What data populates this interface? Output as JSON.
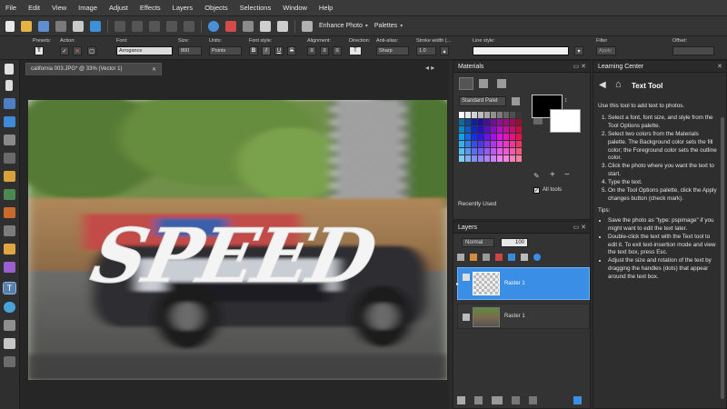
{
  "menu": [
    "File",
    "Edit",
    "View",
    "Image",
    "Adjust",
    "Effects",
    "Layers",
    "Objects",
    "Selections",
    "Window",
    "Help"
  ],
  "toolbar": {
    "enhance_photo": "Enhance Photo",
    "palettes": "Palettes"
  },
  "tool_options": {
    "presets_label": "Presets:",
    "action_label": "Action:",
    "font_label": "Font:",
    "font_value": "Arrogance",
    "size_label": "Size:",
    "size_value": "800",
    "units_label": "Units:",
    "units_value": "Points",
    "font_style_label": "Font style:",
    "font_style_buttons": [
      "B",
      "I",
      "U",
      "S"
    ],
    "alignment_label": "Alignment:",
    "direction_label": "Direction:",
    "antialias_label": "Anti-alias:",
    "antialias_value": "Sharp",
    "stroke_width_label": "Stroke width (...",
    "stroke_width_value": "1.0",
    "line_style_label": "Line style:",
    "filter_label": "Filter",
    "filter_value": "Apply",
    "offset_label": "Offset:"
  },
  "document": {
    "tab_title": "california 003.JPG* @ 33% (Vector 1)",
    "text_overlay": "SPEED"
  },
  "materials": {
    "title": "Materials",
    "palette_select": "Standard Palet",
    "all_tools": "All tools",
    "recently_used": "Recently Used"
  },
  "layers": {
    "title": "Layers",
    "blend_mode": "Normal",
    "opacity": "100",
    "items": [
      {
        "name": "Raster 1",
        "selected": true
      },
      {
        "name": "Raster 1",
        "selected": false
      }
    ]
  },
  "learning_center": {
    "title": "Learning Center",
    "heading": "Text Tool",
    "intro": "Use this tool to add text to photos.",
    "steps": [
      "Select a font, font size, and style from the Tool Options palette.",
      "Select two colors from the Materials palette. The Background color sets the fill color; the Foreground color sets the outline color.",
      "Click the photo where you want the text to start.",
      "Type the text.",
      "On the Tool Options palette, click the Apply changes button (check mark)."
    ],
    "tips_label": "Tips:",
    "tips": [
      "Save the photo as \"type: pspimage\" if you might want to edit the text later.",
      "Double-click the text with the Text tool to edit it. To exit text-insertion mode and view the text box, press Esc.",
      "Adjust the size and rotation of the text by dragging the handles (dots) that appear around the text box."
    ]
  },
  "colors": {
    "accent": "#3a8ee6",
    "panel_bg": "#333333",
    "app_bg": "#2b2b2b"
  }
}
